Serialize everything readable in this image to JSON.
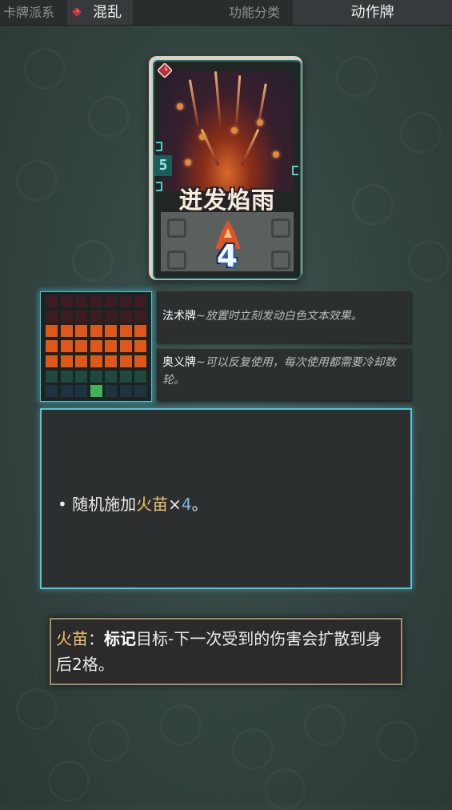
{
  "topbar": {
    "faction_label": "卡牌派系",
    "faction_value": "混乱",
    "faction_icon": "red-gem-icon",
    "function_label": "功能分类",
    "function_value": "动作牌"
  },
  "card": {
    "name": "迸发焰雨",
    "cost": "5",
    "count": "4",
    "art_icon": "fire-rain-icon"
  },
  "grid": {
    "rows": [
      [
        "dark",
        "dark",
        "dark",
        "dark",
        "dark",
        "dark",
        "dark"
      ],
      [
        "dark",
        "dark",
        "dark",
        "dark",
        "dark",
        "dark",
        "dark"
      ],
      [
        "orange",
        "orange",
        "orange",
        "orange",
        "orange",
        "orange",
        "orange"
      ],
      [
        "orange",
        "orange",
        "orange",
        "orange",
        "orange",
        "orange",
        "orange"
      ],
      [
        "orange",
        "orange",
        "orange",
        "orange",
        "orange",
        "orange",
        "orange"
      ],
      [
        "teal",
        "teal",
        "teal",
        "teal",
        "teal",
        "teal",
        "teal"
      ],
      [
        "navy",
        "navy",
        "navy",
        "green",
        "navy",
        "navy",
        "navy"
      ]
    ],
    "colors": {
      "dark": "#3a1c22",
      "orange": "#e0571a",
      "teal": "#1d4a3c",
      "navy": "#1d3440",
      "green": "#3fb55a"
    }
  },
  "info": [
    {
      "keyword": "法术牌",
      "text": "~放置时立刻发动白色文本效果。"
    },
    {
      "keyword": "奥义牌",
      "text": "~可以反复使用，每次使用都需要冷却数轮。"
    }
  ],
  "description": {
    "bullet": "•",
    "prefix": "随机施加",
    "highlight": "火苗",
    "times": "×",
    "amount": "4",
    "suffix": "。"
  },
  "tooltip": {
    "term": "火苗",
    "colon": "：",
    "bold": "标记",
    "text": "目标-下一次受到的伤害会扩散到身后2格。"
  },
  "colors": {
    "accent_cyan": "#58c4d4",
    "highlight_gold": "#f3c26a",
    "number_blue": "#7fb8e6"
  }
}
